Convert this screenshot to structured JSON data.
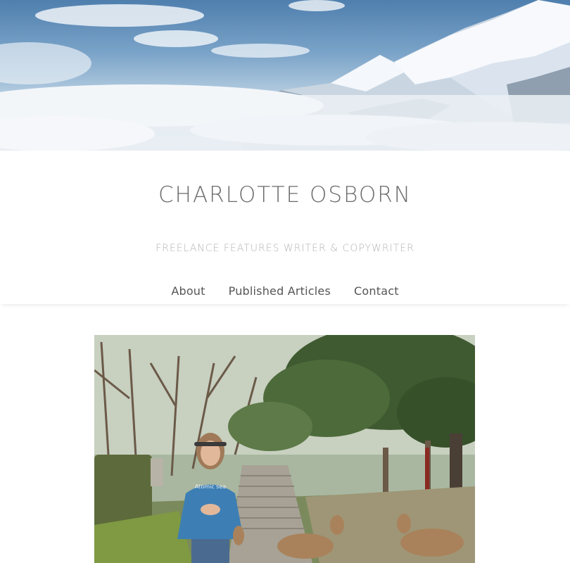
{
  "site": {
    "title": "CHARLOTTE OSBORN",
    "tagline": "FREELANCE FEATURES WRITER & COPYWRITER"
  },
  "nav": {
    "items": [
      {
        "label": "About"
      },
      {
        "label": "Published Articles"
      },
      {
        "label": "Contact"
      }
    ]
  },
  "hero": {
    "image": "snowy-mountain-peaks-above-clouds"
  },
  "featured_image": {
    "image": "woman-in-blue-sweatshirt-on-park-path-with-deer",
    "sweatshirt_text": "Atomic sea"
  },
  "colors": {
    "title": "#6b6b6b",
    "tagline": "#b3b3b3",
    "nav": "#555555",
    "background": "#ffffff"
  }
}
